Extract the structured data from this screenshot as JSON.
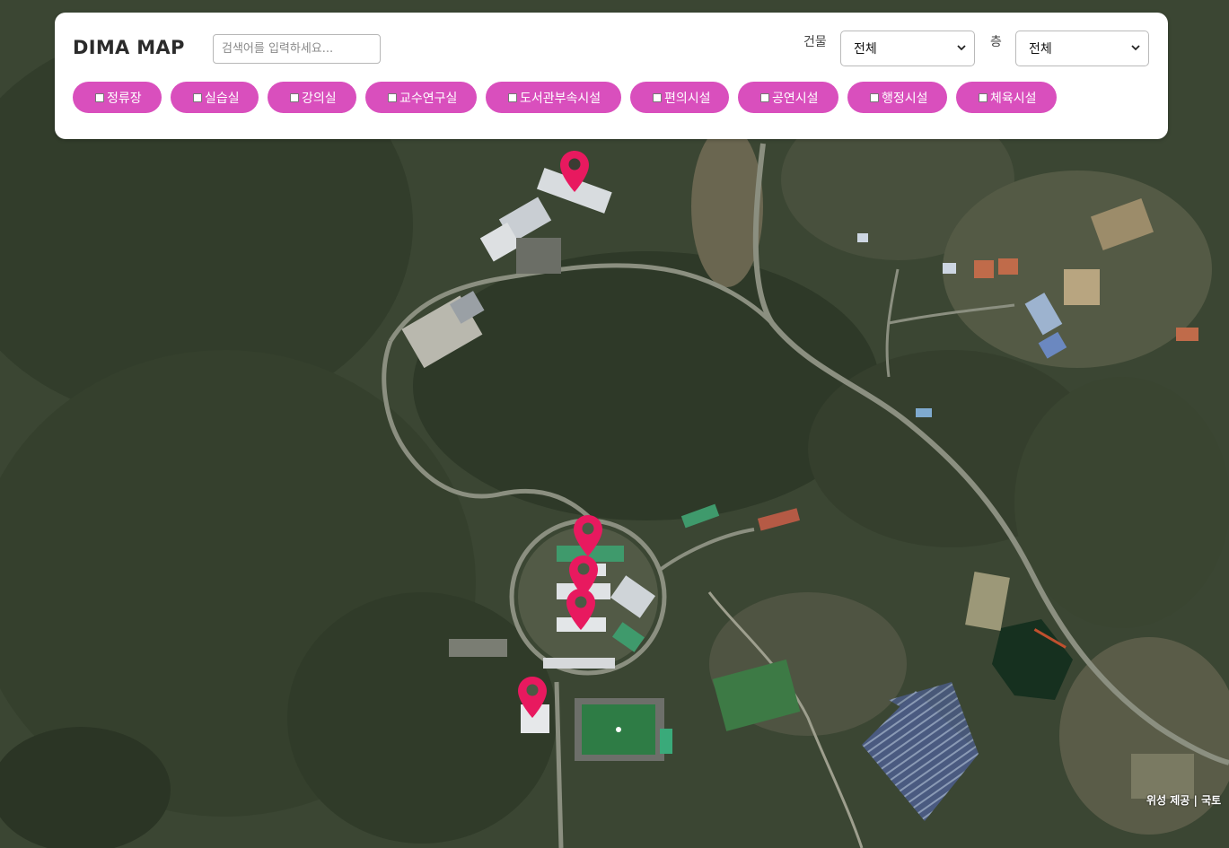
{
  "app": {
    "title": "DIMA MAP"
  },
  "search": {
    "placeholder": "검색어를 입력하세요..."
  },
  "filters": {
    "building_label": "건물",
    "building_value": "전체",
    "floor_label": "층",
    "floor_value": "전체"
  },
  "categories": [
    {
      "label": "정류장",
      "checked": false
    },
    {
      "label": "실습실",
      "checked": false
    },
    {
      "label": "강의실",
      "checked": false
    },
    {
      "label": "교수연구실",
      "checked": false
    },
    {
      "label": "도서관부속시설",
      "checked": false
    },
    {
      "label": "편의시설",
      "checked": false
    },
    {
      "label": "공연시설",
      "checked": false
    },
    {
      "label": "행정시설",
      "checked": false
    },
    {
      "label": "체육시설",
      "checked": false
    }
  ],
  "map": {
    "type": "satellite",
    "attribution": "위성 제공  |  국토"
  },
  "colors": {
    "chip": "#d94fbd",
    "marker": "#e8195f",
    "panel": "#ffffff"
  },
  "markers": [
    {
      "icon": "map-pin-icon"
    },
    {
      "icon": "map-pin-icon"
    },
    {
      "icon": "map-pin-icon"
    },
    {
      "icon": "map-pin-icon"
    },
    {
      "icon": "map-pin-icon"
    }
  ]
}
